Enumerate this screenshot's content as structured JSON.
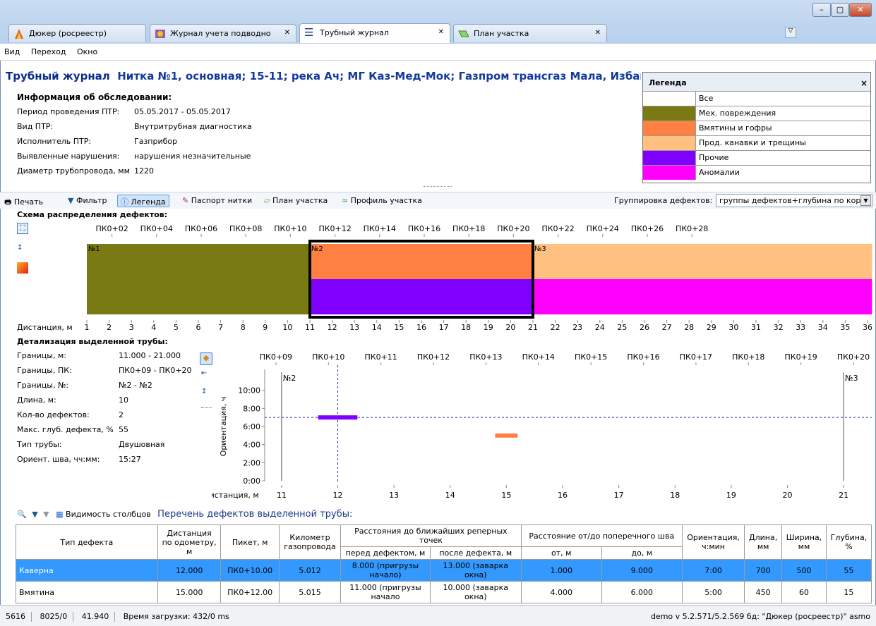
{
  "tabs": [
    {
      "label": "Дюкер (росреестр)"
    },
    {
      "label": "Журнал учета подводно"
    },
    {
      "label": "Трубный журнал"
    },
    {
      "label": "План участка"
    }
  ],
  "menu": [
    "Вид",
    "Переход",
    "Окно"
  ],
  "header": {
    "title": "Трубный журнал",
    "subtitle": "Нитка №1, основная; 15-11; река Ач; МГ Каз-Мед-Мок; Газпром трансгаз Мала, Избашс"
  },
  "survey": {
    "heading": "Информация об обследовании:",
    "rows": [
      {
        "label": "Период проведения ПТР:",
        "value": "05.05.2017 - 05.05.2017"
      },
      {
        "label": "Вид ПТР:",
        "value": "Внутритрубная диагностика"
      },
      {
        "label": "Исполнитель ПТР:",
        "value": "Газприбор"
      },
      {
        "label": "Выявленные нарушения:",
        "value": "нарушения незначительные"
      },
      {
        "label": "Диаметр трубопровода, мм",
        "value": "1220"
      }
    ]
  },
  "legend": {
    "title": "Легенда",
    "items": [
      {
        "label": "Все",
        "color": "#ffffff"
      },
      {
        "label": "Мех. повреждения",
        "color": "#7a7a14"
      },
      {
        "label": "Вмятины и гофры",
        "color": "#ff8040"
      },
      {
        "label": "Прод. канавки и трещины",
        "color": "#ffc080"
      },
      {
        "label": "Прочие",
        "color": "#8000ff"
      },
      {
        "label": "Аномалии",
        "color": "#ff00ff"
      }
    ]
  },
  "toolbar": {
    "print": "Печать",
    "filter": "Фильтр",
    "legend": "Легенда",
    "passport": "Паспорт нитки",
    "plan": "План участка",
    "profile": "Профиль участка",
    "grouping_label": "Группировка дефектов:",
    "grouping_value": "группы дефектов+глубина по корр"
  },
  "scheme": {
    "heading": "Схема распределения дефектов:",
    "pk_labels": [
      "ПК0+02",
      "ПК0+04",
      "ПК0+06",
      "ПК0+08",
      "ПК0+10",
      "ПК0+12",
      "ПК0+14",
      "ПК0+16",
      "ПК0+18",
      "ПК0+20",
      "ПК0+22",
      "ПК0+24",
      "ПК0+26",
      "ПК0+28"
    ],
    "distance_label": "Дистанция, м",
    "distance_ticks": [
      "1",
      "2",
      "3",
      "4",
      "5",
      "6",
      "7",
      "8",
      "9",
      "10",
      "11",
      "12",
      "13",
      "14",
      "15",
      "16",
      "17",
      "18",
      "19",
      "20",
      "21",
      "22",
      "23",
      "24",
      "25",
      "26",
      "27",
      "28",
      "29",
      "30",
      "31",
      "32",
      "33",
      "34",
      "35",
      "36"
    ],
    "pipes": [
      {
        "label": "№1"
      },
      {
        "label": "№2"
      },
      {
        "label": "№3"
      }
    ]
  },
  "detail": {
    "heading": "Детализация выделенной трубы:",
    "rows": [
      {
        "label": "Границы, м:",
        "value": "11.000 - 21.000"
      },
      {
        "label": "Границы, ПК:",
        "value": "ПК0+09 - ПК0+20"
      },
      {
        "label": "Границы, №:",
        "value": "№2 - №2"
      },
      {
        "label": "Длина, м:",
        "value": "10"
      },
      {
        "label": "Кол-во дефектов:",
        "value": "2"
      },
      {
        "label": "Макс. глуб. дефекта, %",
        "value": "55"
      },
      {
        "label": "Тип трубы:",
        "value": "Двушовная"
      },
      {
        "label": "Ориент. шва, чч:мм:",
        "value": "15:27"
      }
    ]
  },
  "chart_data": {
    "type": "scatter",
    "xlabel": "Дистанция, м",
    "ylabel": "Ориентация, ч",
    "xlim": [
      10.7,
      21.5
    ],
    "ylim": [
      0,
      12
    ],
    "x_ticks": [
      "11",
      "12",
      "13",
      "14",
      "15",
      "16",
      "17",
      "18",
      "19",
      "20",
      "21"
    ],
    "y_ticks": [
      "0:00",
      "2:00",
      "4:00",
      "6:00",
      "8:00",
      "10:00"
    ],
    "pk_labels": [
      "ПК0+09",
      "ПК0+10",
      "ПК0+11",
      "ПК0+12",
      "ПК0+13",
      "ПК0+14",
      "ПК0+15",
      "ПК0+16",
      "ПК0+17",
      "ПК0+18",
      "ПК0+19",
      "ПК0+20"
    ],
    "pipe_labels": [
      "№2",
      "№3"
    ],
    "seam_orientation_h": 7,
    "selected_distance": 12,
    "defects": [
      {
        "start": 11.65,
        "end": 12.35,
        "orientation": 7,
        "color": "#8000ff"
      },
      {
        "start": 14.8,
        "end": 15.2,
        "orientation": 5,
        "color": "#ff8040"
      }
    ]
  },
  "list_toolbar": {
    "columns_visibility": "Видимость столбцов",
    "list_title": "Перечень дефектов выделенной трубы:"
  },
  "table": {
    "headers": {
      "type": "Тип дефекта",
      "odometer": "Дистанция по одометру, м",
      "picket": "Пикет, м",
      "km": "Километр газопровода",
      "ref_group": "Расстояния до ближайших реперных точек",
      "ref_before": "перед дефектом, м",
      "ref_after": "после дефекта, м",
      "seam_group": "Расстояние от/до поперечного шва",
      "seam_from": "от, м",
      "seam_to": "до, м",
      "orient": "Ориентация, ч:мин",
      "length": "Длина, мм",
      "width": "Ширина, мм",
      "depth": "Глубина, %"
    },
    "rows": [
      {
        "type": "Каверна",
        "odometer": "12.000",
        "picket": "ПК0+10.00",
        "km": "5.012",
        "before": "8.000 (пригрузы начало)",
        "after": "13.000 (заварка окна)",
        "from": "1.000",
        "to": "9.000",
        "orient": "7:00",
        "length": "700",
        "width": "500",
        "depth": "55",
        "selected": true
      },
      {
        "type": "Вмятина",
        "odometer": "15.000",
        "picket": "ПК0+12.00",
        "km": "5.015",
        "before": "11.000 (пригрузы начало",
        "after": "10.000 (заварка окна)",
        "from": "4.000",
        "to": "6.000",
        "orient": "5:00",
        "length": "450",
        "width": "60",
        "depth": "15",
        "selected": false
      }
    ]
  },
  "status": {
    "a": "5616",
    "b": "8025/0",
    "c": "41.940",
    "load": "Время загрузки: 432/0 ms",
    "right": "demo  v 5.2.571/5.2.569  бд: \"Дюкер (росреестр)\" asmo"
  }
}
